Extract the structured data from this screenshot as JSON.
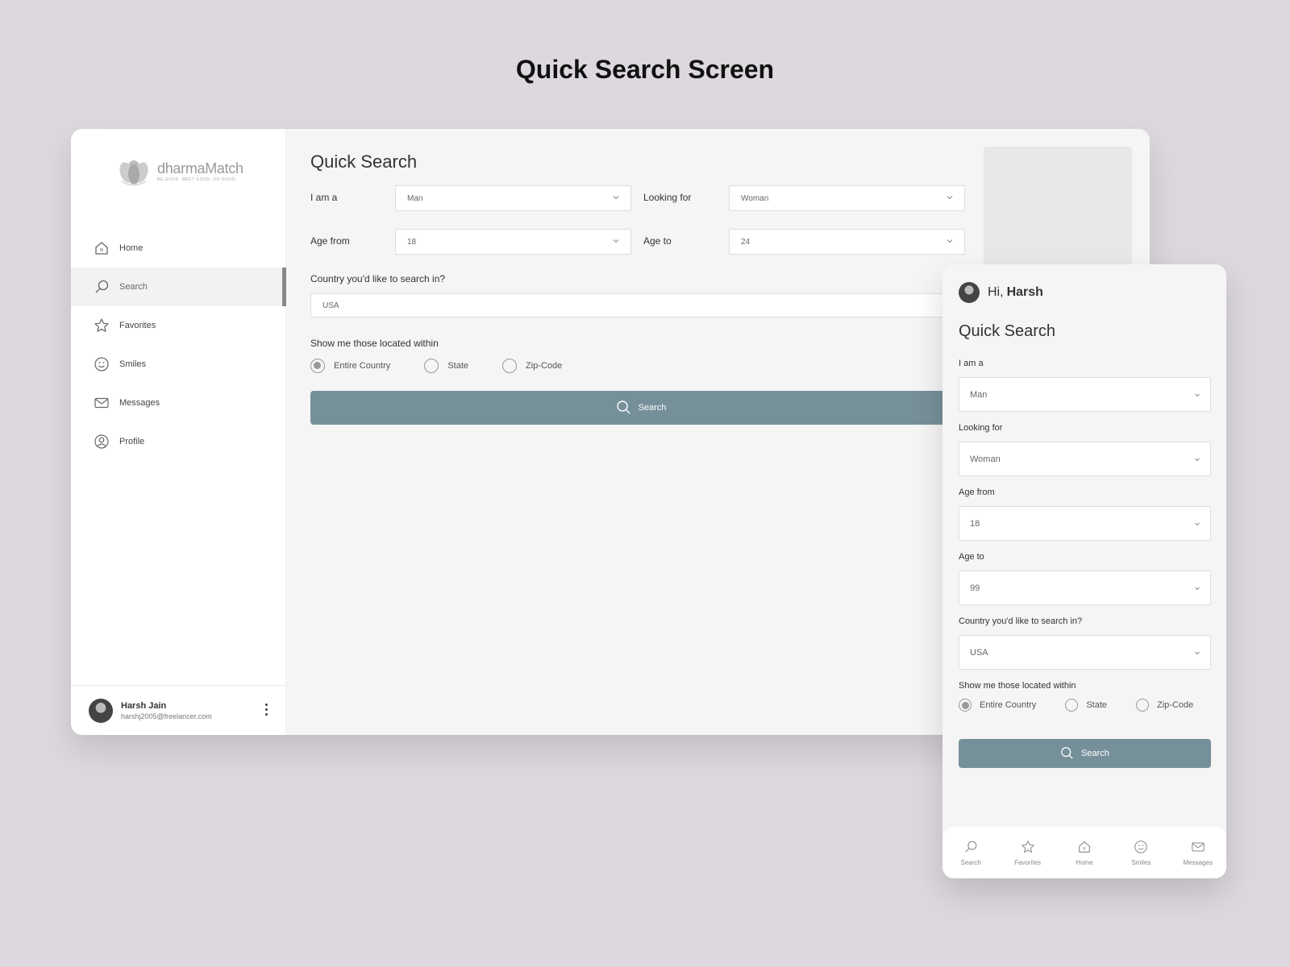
{
  "page_heading": "Quick Search Screen",
  "brand": {
    "name": "dharmaMatch",
    "tagline": "BE GOOD. MEET GOOD. DO GOOD."
  },
  "sidebar": {
    "items": [
      {
        "label": "Home",
        "icon": "home-icon"
      },
      {
        "label": "Search",
        "icon": "search-icon",
        "active": true
      },
      {
        "label": "Favorites",
        "icon": "star-icon"
      },
      {
        "label": "Smiles",
        "icon": "smile-icon"
      },
      {
        "label": "Messages",
        "icon": "mail-icon"
      },
      {
        "label": "Profile",
        "icon": "user-icon"
      }
    ],
    "user": {
      "name": "Harsh Jain",
      "email": "harshj2005@freelancer.com"
    }
  },
  "desktop_form": {
    "title": "Quick Search",
    "i_am_label": "I am a",
    "i_am_value": "Man",
    "looking_for_label": "Looking for",
    "looking_for_value": "Woman",
    "age_from_label": "Age from",
    "age_from_value": "18",
    "age_to_label": "Age to",
    "age_to_value": "24",
    "country_label": "Country you'd like to search in?",
    "country_value": "USA",
    "within_label": "Show me those located within",
    "radios": [
      "Entire Country",
      "State",
      "Zip-Code"
    ],
    "selected_radio": "Entire Country",
    "search_label": "Search"
  },
  "mobile": {
    "greeting": "Hi,",
    "greeting_name": "Harsh",
    "title": "Quick Search",
    "i_am_label": "I am a",
    "i_am_value": "Man",
    "looking_for_label": "Looking for",
    "looking_for_value": "Woman",
    "age_from_label": "Age from",
    "age_from_value": "18",
    "age_to_label": "Age to",
    "age_to_value": "99",
    "country_label": "Country you'd like to search in?",
    "country_value": "USA",
    "within_label": "Show me those located within",
    "radios": [
      "Entire Country",
      "State",
      "Zip-Code"
    ],
    "selected_radio": "Entire Country",
    "search_label": "Search",
    "tabs": [
      {
        "label": "Search",
        "icon": "search-icon"
      },
      {
        "label": "Favorites",
        "icon": "star-icon"
      },
      {
        "label": "Home",
        "icon": "home-icon"
      },
      {
        "label": "Smiles",
        "icon": "smile-icon"
      },
      {
        "label": "Messages",
        "icon": "mail-icon"
      }
    ]
  },
  "colors": {
    "accent": "#76909a",
    "background": "#dcd8de"
  }
}
